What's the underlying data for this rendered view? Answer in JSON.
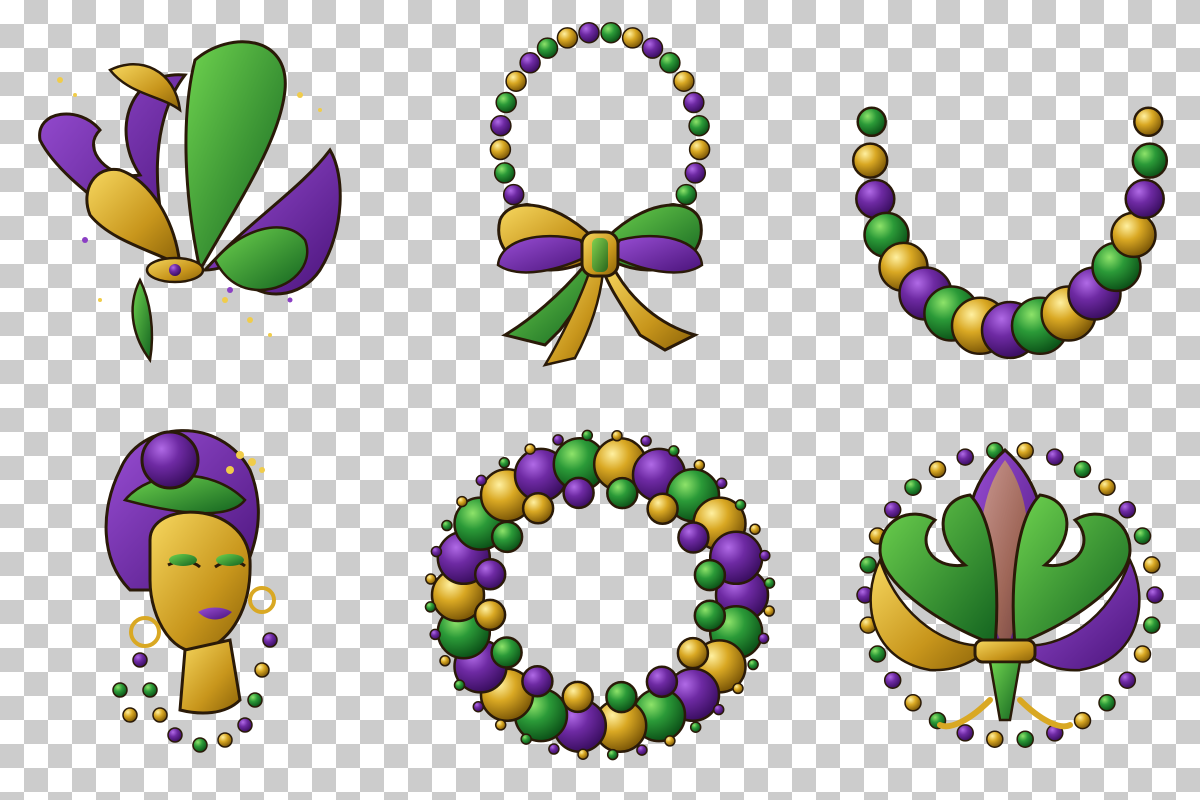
{
  "colors": {
    "purple": "#5e1f8f",
    "purple_light": "#8b3fc4",
    "green": "#1f8a2e",
    "green_light": "#4dbb3a",
    "gold": "#c89a1e",
    "gold_light": "#f0cc4a",
    "outline": "#2a1a08",
    "checker_light": "#ffffff",
    "checker_dark": "#cccccc"
  },
  "items": [
    {
      "name": "fleur-de-lis-swirl",
      "colors": [
        "purple",
        "green",
        "gold"
      ]
    },
    {
      "name": "bead-necklace-with-bow",
      "colors": [
        "purple",
        "green",
        "gold"
      ]
    },
    {
      "name": "large-bead-necklace",
      "colors": [
        "purple",
        "green",
        "gold"
      ]
    },
    {
      "name": "woman-portrait-with-beads",
      "colors": [
        "purple",
        "green",
        "gold"
      ]
    },
    {
      "name": "bead-wreath",
      "colors": [
        "purple",
        "green",
        "gold"
      ]
    },
    {
      "name": "fleur-de-lis-with-beads",
      "colors": [
        "purple",
        "green",
        "gold"
      ]
    }
  ]
}
